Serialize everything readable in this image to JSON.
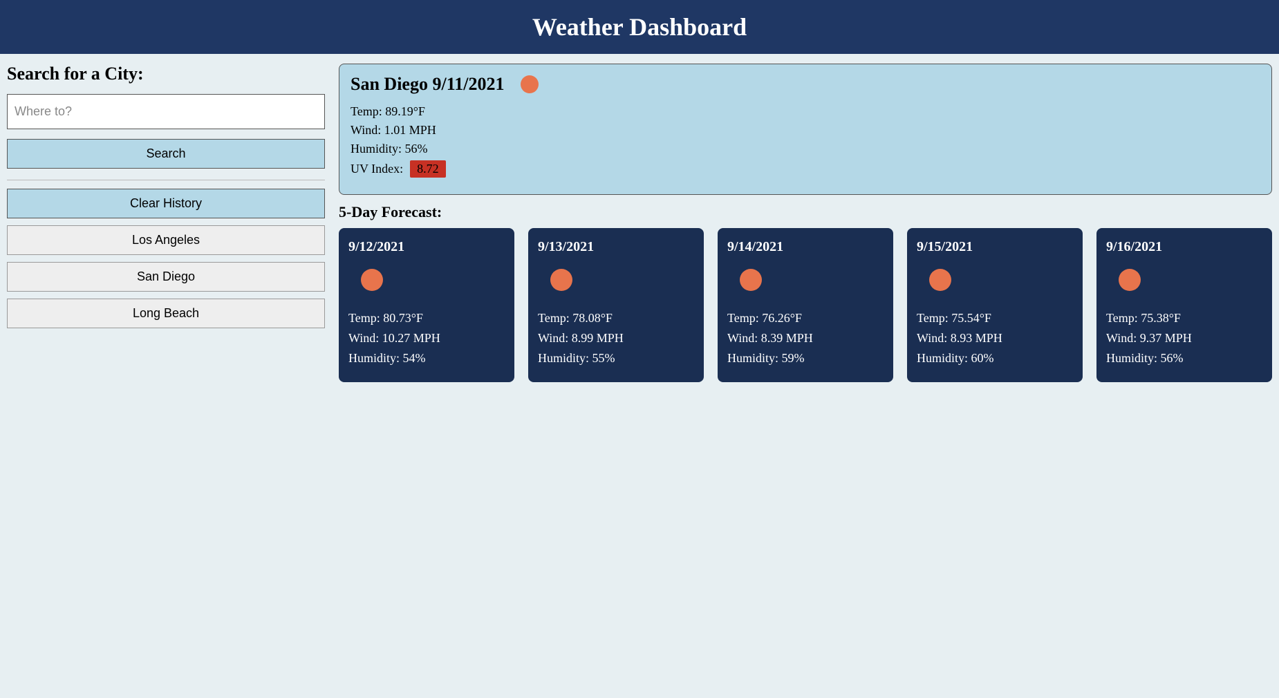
{
  "header": {
    "title": "Weather Dashboard"
  },
  "sidebar": {
    "search_title": "Search for a City:",
    "search_placeholder": "Where to?",
    "search_value": "",
    "search_button": "Search",
    "clear_button": "Clear History",
    "history": [
      "Los Angeles",
      "San Diego",
      "Long Beach"
    ]
  },
  "current": {
    "city": "San Diego",
    "date": "9/11/2021",
    "icon": "sun-icon",
    "labels": {
      "temp": "Temp: ",
      "wind": "Wind: ",
      "humidity": "Humidity: ",
      "uv": "UV Index: "
    },
    "temp": "89.19°F",
    "wind": "1.01 MPH",
    "humidity": "56%",
    "uv_index": "8.72",
    "uv_color": "#c73124"
  },
  "forecast_title": "5-Day Forecast:",
  "forecast_labels": {
    "temp": "Temp: ",
    "wind": "Wind: ",
    "humidity": "Humidity: "
  },
  "forecast": [
    {
      "date": "9/12/2021",
      "icon": "sun-icon",
      "temp": "80.73°F",
      "wind": "10.27 MPH",
      "humidity": "54%"
    },
    {
      "date": "9/13/2021",
      "icon": "sun-icon",
      "temp": "78.08°F",
      "wind": "8.99 MPH",
      "humidity": "55%"
    },
    {
      "date": "9/14/2021",
      "icon": "sun-icon",
      "temp": "76.26°F",
      "wind": "8.39 MPH",
      "humidity": "59%"
    },
    {
      "date": "9/15/2021",
      "icon": "sun-icon",
      "temp": "75.54°F",
      "wind": "8.93 MPH",
      "humidity": "60%"
    },
    {
      "date": "9/16/2021",
      "icon": "sun-icon",
      "temp": "75.38°F",
      "wind": "9.37 MPH",
      "humidity": "56%"
    }
  ]
}
